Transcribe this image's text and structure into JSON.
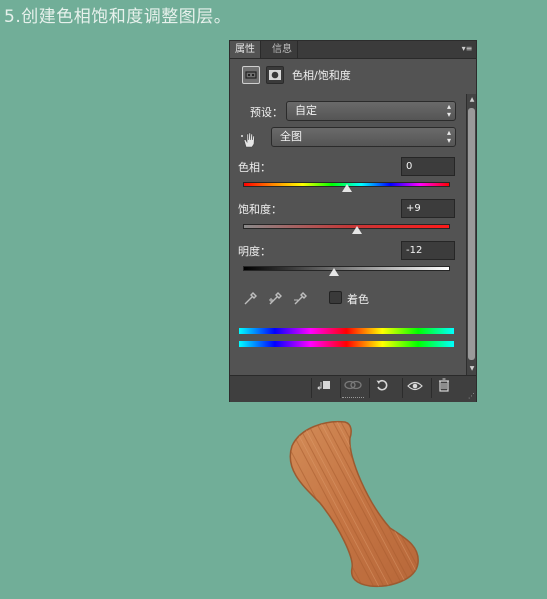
{
  "step_title": "5.创建色相饱和度调整图层。",
  "panel": {
    "tabs": [
      {
        "label": "属性",
        "active": true
      },
      {
        "label": "信息",
        "active": false
      }
    ],
    "header_title": "色相/饱和度",
    "preset": {
      "label": "预设：",
      "value": "自定"
    },
    "channel": {
      "value": "全图"
    },
    "hue": {
      "label": "色相：",
      "value": "0",
      "level": 0.5
    },
    "saturation": {
      "label": "饱和度：",
      "value": "+9",
      "level": 0.55
    },
    "lightness": {
      "label": "明度：",
      "value": "-12",
      "level": 0.44
    },
    "colorize": {
      "label": "着色",
      "checked": false
    },
    "icons": {
      "adjustment": "hue-saturation-icon",
      "mask": "mask-icon",
      "targeted_adjust": "hand-icon",
      "eyedroppers": [
        "eyedropper-icon",
        "eyedropper-plus-icon",
        "eyedropper-minus-icon"
      ],
      "bottom": [
        "clip-to-layer-icon",
        "view-previous-icon",
        "reset-icon",
        "visibility-icon",
        "trash-icon"
      ]
    }
  },
  "colors": {
    "background": "#71ae98",
    "panel": "#535353",
    "wood": "#c67a48"
  }
}
